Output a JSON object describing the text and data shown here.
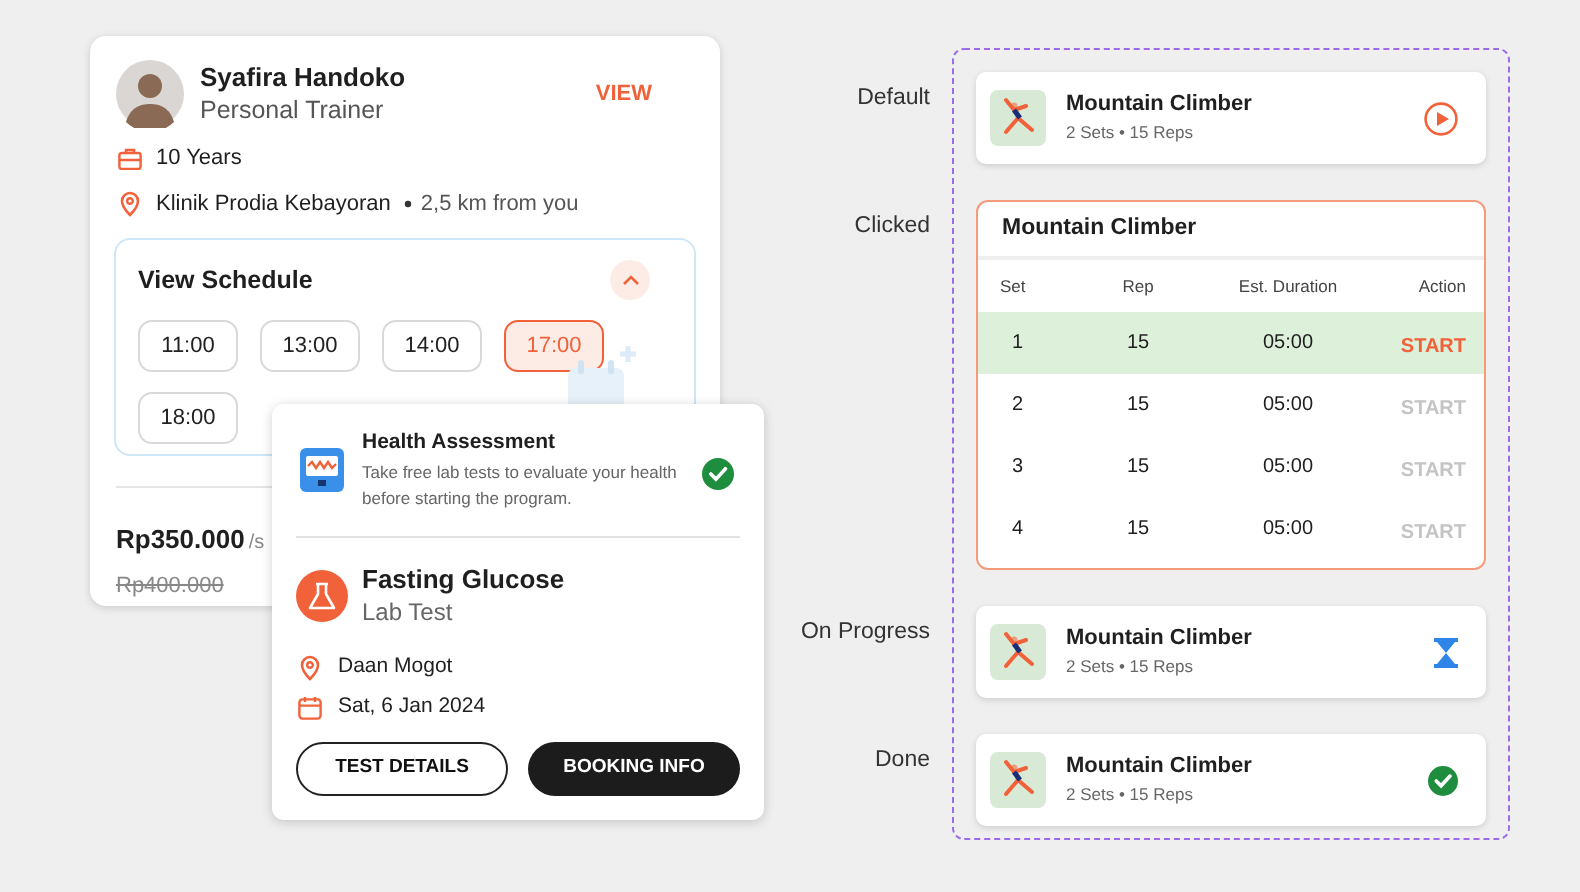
{
  "trainer_card": {
    "name": "Syafira Handoko",
    "role": "Personal Trainer",
    "view_link": "VIEW",
    "experience": "10 Years",
    "location": "Klinik Prodia Kebayoran",
    "distance": "2,5 km from you",
    "schedule": {
      "title": "View Schedule",
      "expanded": true,
      "slots": [
        {
          "time": "11:00",
          "selected": false
        },
        {
          "time": "13:00",
          "selected": false
        },
        {
          "time": "14:00",
          "selected": false
        },
        {
          "time": "17:00",
          "selected": true
        },
        {
          "time": "18:00",
          "selected": false
        }
      ]
    },
    "price": "Rp350.000",
    "price_unit": "/s",
    "old_price": "Rp400.000"
  },
  "booking_card": {
    "assessment": {
      "title": "Health Assessment",
      "description": "Take free lab tests to evaluate your health before starting the program.",
      "checked": true
    },
    "test": {
      "title": "Fasting Glucose",
      "subtitle": "Lab Test",
      "location": "Daan Mogot",
      "date": "Sat, 6 Jan 2024"
    },
    "buttons": [
      {
        "label": "TEST DETAILS",
        "kind": "outline"
      },
      {
        "label": "BOOKING INFO",
        "kind": "filled"
      }
    ]
  },
  "states": [
    {
      "label": "Default",
      "kind": "play",
      "title": "Mountain Climber",
      "subtitle": "2 Sets • 15 Reps"
    },
    {
      "label": "Clicked",
      "kind": "expanded",
      "title": "Mountain Climber",
      "columns": [
        "Set",
        "Rep",
        "Est. Duration",
        "Action"
      ],
      "rows": [
        {
          "set": "1",
          "rep": "15",
          "duration": "05:00",
          "action": "START",
          "active": true
        },
        {
          "set": "2",
          "rep": "15",
          "duration": "05:00",
          "action": "START",
          "active": false
        },
        {
          "set": "3",
          "rep": "15",
          "duration": "05:00",
          "action": "START",
          "active": false
        },
        {
          "set": "4",
          "rep": "15",
          "duration": "05:00",
          "action": "START",
          "active": false
        }
      ]
    },
    {
      "label": "On Progress",
      "kind": "progress",
      "title": "Mountain Climber",
      "subtitle": "2 Sets • 15 Reps"
    },
    {
      "label": "Done",
      "kind": "done",
      "title": "Mountain Climber",
      "subtitle": "2 Sets • 15 Reps"
    }
  ]
}
